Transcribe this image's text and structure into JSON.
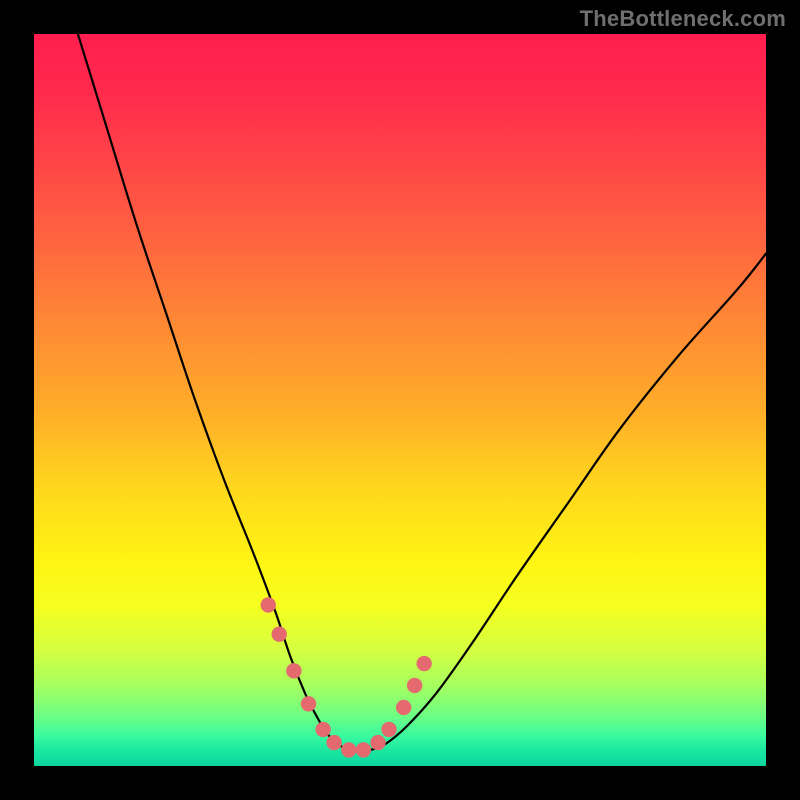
{
  "watermark": {
    "text": "TheBottleneck.com"
  },
  "colors": {
    "page_bg": "#000000",
    "curve_stroke": "#000000",
    "marker_fill": "#e46a6f",
    "gradient": [
      "#ff1e4f",
      "#ff4647",
      "#ff8a34",
      "#ffd71d",
      "#f6ff1f",
      "#6fff82",
      "#0cd59e"
    ]
  },
  "chart_data": {
    "type": "line",
    "title": "",
    "xlabel": "",
    "ylabel": "",
    "xlim": [
      0,
      100
    ],
    "ylim": [
      0,
      100
    ],
    "grid": false,
    "legend": false,
    "series": [
      {
        "name": "bottleneck-curve",
        "x": [
          6,
          10,
          14,
          18,
          22,
          26,
          30,
          33,
          35,
          37,
          38.5,
          40,
          41.5,
          43,
          44.5,
          46,
          48,
          51,
          55,
          60,
          66,
          73,
          80,
          88,
          96,
          100
        ],
        "y": [
          100,
          87,
          74,
          62,
          50,
          39,
          29,
          21,
          15,
          10,
          7,
          4.5,
          3,
          2.2,
          2,
          2.2,
          3,
          5.5,
          10,
          17,
          26,
          36,
          46,
          56,
          65,
          70
        ]
      }
    ],
    "markers": {
      "name": "highlight-dots",
      "color": "#e46a6f",
      "radius_domain": 1.05,
      "points": [
        {
          "x": 32.0,
          "y": 22.0
        },
        {
          "x": 33.5,
          "y": 18.0
        },
        {
          "x": 35.5,
          "y": 13.0
        },
        {
          "x": 37.5,
          "y": 8.5
        },
        {
          "x": 39.5,
          "y": 5.0
        },
        {
          "x": 41.0,
          "y": 3.2
        },
        {
          "x": 43.0,
          "y": 2.2
        },
        {
          "x": 45.0,
          "y": 2.2
        },
        {
          "x": 47.0,
          "y": 3.2
        },
        {
          "x": 48.5,
          "y": 5.0
        },
        {
          "x": 50.5,
          "y": 8.0
        },
        {
          "x": 52.0,
          "y": 11.0
        },
        {
          "x": 53.3,
          "y": 14.0
        }
      ]
    }
  }
}
